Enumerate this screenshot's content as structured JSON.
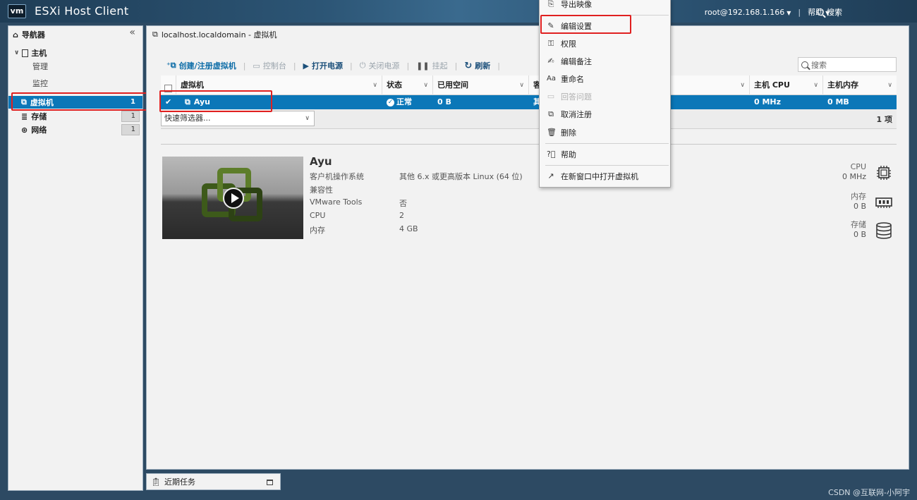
{
  "header": {
    "logo": "vm",
    "title": "ESXi Host Client",
    "user": "root@192.168.1.166",
    "help": "帮助",
    "search": "搜索"
  },
  "navigator": {
    "title": "导航器",
    "host": "主机",
    "host_children": [
      "管理",
      "监控"
    ],
    "items": [
      {
        "label": "虚拟机",
        "count": "1",
        "active": true
      },
      {
        "label": "存储",
        "count": "1",
        "active": false
      },
      {
        "label": "网络",
        "count": "1",
        "active": false
      }
    ]
  },
  "breadcrumb": "localhost.localdomain - 虚拟机",
  "toolbar": {
    "create": "创建/注册虚拟机",
    "console": "控制台",
    "power_on": "打开电源",
    "power_off": "关闭电源",
    "suspend": "挂起",
    "refresh": "刷新",
    "search_placeholder": "搜索"
  },
  "grid": {
    "columns": [
      "虚拟机",
      "状态",
      "已用空间",
      "客",
      "主机 CPU",
      "主机内存"
    ],
    "rows": [
      {
        "name": "Ayu",
        "status": "正常",
        "used_space": "0 B",
        "guest": "其",
        "host_cpu": "0 MHz",
        "host_mem": "0 MB"
      }
    ],
    "quick_filter": "快速筛选器...",
    "item_count": "1 项"
  },
  "details": {
    "name": "Ayu",
    "props": [
      {
        "label": "客户机操作系统",
        "value": "其他 6.x 或更高版本 Linux (64 位)"
      },
      {
        "label": "兼容性",
        "value": ""
      },
      {
        "label": "VMware Tools",
        "value": "否"
      },
      {
        "label": "CPU",
        "value": "2"
      },
      {
        "label": "内存",
        "value": "4 GB"
      }
    ],
    "resources": [
      {
        "label": "CPU",
        "value": "0 MHz",
        "icon": "cpu-icon"
      },
      {
        "label": "内存",
        "value": "0 B",
        "icon": "memory-icon"
      },
      {
        "label": "存储",
        "value": "0 B",
        "icon": "storage-icon"
      }
    ]
  },
  "recent_tasks": "近期任务",
  "context_menu": {
    "items": [
      {
        "label": "导出映像",
        "disabled": false
      },
      {
        "label": "编辑设置",
        "disabled": false
      },
      {
        "label": "权限",
        "disabled": false
      },
      {
        "label": "编辑备注",
        "disabled": false
      },
      {
        "label": "重命名",
        "disabled": false
      },
      {
        "label": "回答问题",
        "disabled": true
      },
      {
        "label": "取消注册",
        "disabled": false
      },
      {
        "label": "删除",
        "disabled": false
      },
      {
        "label": "帮助",
        "disabled": false
      },
      {
        "label": "在新窗口中打开虚拟机",
        "disabled": false
      }
    ]
  },
  "watermark": "CSDN @互联网-小阿宇",
  "colors": {
    "accent": "#0b77b8",
    "highlight": "#e02020",
    "header": "#2c5575"
  }
}
